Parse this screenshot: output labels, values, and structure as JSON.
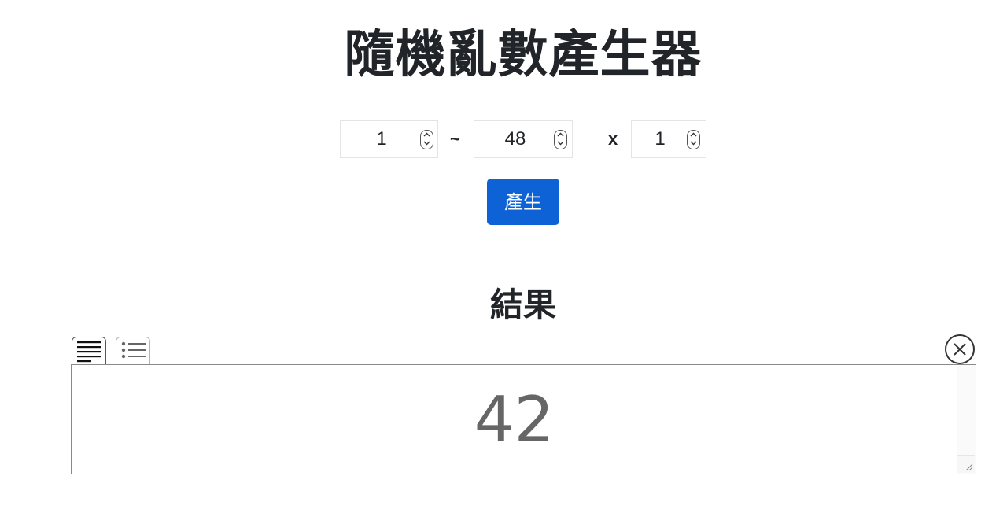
{
  "page_title": "隨機亂數產生器",
  "range": {
    "min_value": "1",
    "separator": "~",
    "max_value": "48",
    "times_symbol": "x",
    "count_value": "1"
  },
  "generate_button_label": "產生",
  "result": {
    "heading": "結果",
    "value": "42",
    "tabs": [
      {
        "icon": "text-lines-icon",
        "active": true
      },
      {
        "icon": "bulleted-list-icon",
        "active": false
      }
    ],
    "close_icon": "close-circle-icon"
  },
  "colors": {
    "button_background": "#0d63d6",
    "button_text": "#ffffff",
    "result_text": "#666666"
  }
}
